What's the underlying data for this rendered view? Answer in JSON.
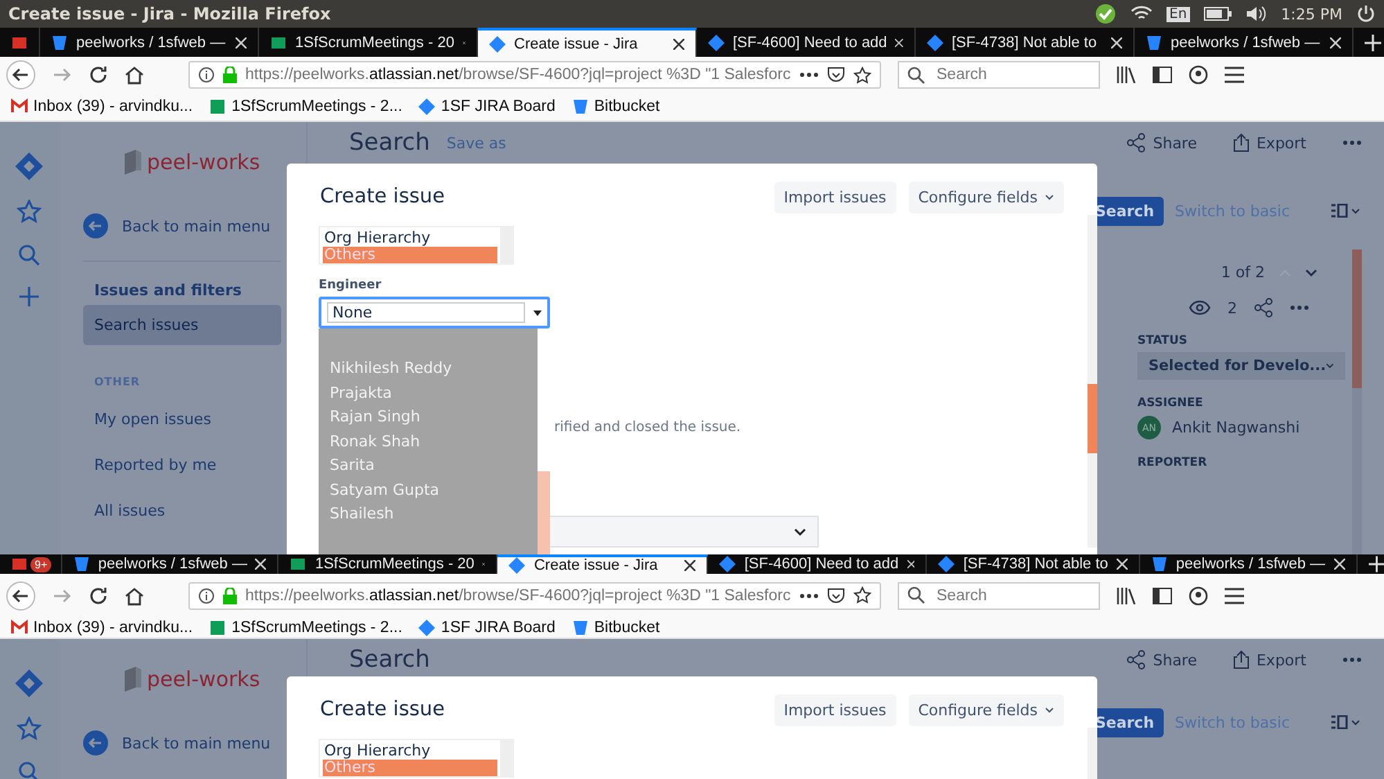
{
  "window": {
    "title": "Create issue - Jira - Mozilla Firefox",
    "language": "En",
    "time": "1:25 PM"
  },
  "frames": [
    {
      "tabs": [
        {
          "kind": "mail",
          "selected": false
        },
        {
          "label": "peelworks / 1sfweb —",
          "kind": "bucket",
          "selected": false
        },
        {
          "label": "1SfScrumMeetings - 20",
          "kind": "sheet",
          "selected": false
        },
        {
          "label": "Create issue - Jira",
          "kind": "jira",
          "selected": true
        },
        {
          "label": "[SF-4600] Need to add",
          "kind": "jira",
          "selected": false
        },
        {
          "label": "[SF-4738] Not able to",
          "kind": "jira",
          "selected": false
        },
        {
          "label": "peelworks / 1sfweb —",
          "kind": "bucket",
          "selected": false
        }
      ],
      "url": {
        "start": "https://peelworks.",
        "domain": "atlassian.net",
        "rest": "/browse/SF-4600?jql=project %3D \"1 Salesforc"
      },
      "search_placeholder": "Search",
      "bookmarks": [
        {
          "label": "Inbox (39) - arvindku...",
          "kind": "mail"
        },
        {
          "label": "1SfScrumMeetings - 2...",
          "kind": "sheet"
        },
        {
          "label": "1SF JIRA Board",
          "kind": "jira"
        },
        {
          "label": "Bitbucket",
          "kind": "bucket"
        }
      ],
      "sidebar": {
        "logo": "peel-works",
        "back": "Back to main menu",
        "section": "Issues and filters",
        "items": [
          {
            "label": "Search issues",
            "selected": true
          }
        ],
        "other_heading": "OTHER",
        "other_items": [
          {
            "label": "My open issues",
            "selected": false
          },
          {
            "label": "Reported by me",
            "selected": false
          },
          {
            "label": "All issues",
            "selected": false
          }
        ]
      },
      "header": {
        "title": "Search",
        "save_as": "Save as",
        "share": "Share",
        "export": "Export"
      },
      "search_button": "Search",
      "switch": "Switch to basic",
      "detail": {
        "pager": "1 of 2",
        "watchers": "2",
        "status_label": "STATUS",
        "status": "Selected for Develo...",
        "assignee_label": "ASSIGNEE",
        "assignee_initials": "AN",
        "assignee": "Ankit Nagwanshi",
        "reporter_label": "REPORTER"
      },
      "modal": {
        "title": "Create issue",
        "import": "Import issues",
        "configure": "Configure fields",
        "listbox": [
          {
            "label": "Org Hierarchy",
            "selected": false
          },
          {
            "label": "Others",
            "selected": true
          }
        ],
        "fields": [
          {
            "kind": "select",
            "label": "Engineer",
            "value": "None",
            "focused": true
          }
        ],
        "dropdown": [
          "Nikhilesh Reddy",
          "Prajakta",
          "Rajan Singh",
          "Ronak Shah",
          "Sarita",
          "Satyam Gupta",
          "Shailesh"
        ],
        "covered_hint": "rified and closed the issue."
      }
    },
    {
      "tabs": [
        {
          "kind": "mail",
          "selected": false,
          "badge": "9+"
        },
        {
          "label": "peelworks / 1sfweb —",
          "kind": "bucket",
          "selected": false
        },
        {
          "label": "1SfScrumMeetings - 20",
          "kind": "sheet",
          "selected": false
        },
        {
          "label": "Create issue - Jira",
          "kind": "jira",
          "selected": true
        },
        {
          "label": "[SF-4600] Need to add",
          "kind": "jira",
          "selected": false
        },
        {
          "label": "[SF-4738] Not able to",
          "kind": "jira",
          "selected": false
        },
        {
          "label": "peelworks / 1sfweb —",
          "kind": "bucket",
          "selected": false
        }
      ],
      "url": {
        "start": "https://peelworks.",
        "domain": "atlassian.net",
        "rest": "/browse/SF-4600?jql=project %3D \"1 Salesforc"
      },
      "search_placeholder": "Search",
      "bookmarks": [
        {
          "label": "Inbox (39) - arvindku...",
          "kind": "mail"
        },
        {
          "label": "1SfScrumMeetings - 2...",
          "kind": "sheet"
        },
        {
          "label": "1SF JIRA Board",
          "kind": "jira"
        },
        {
          "label": "Bitbucket",
          "kind": "bucket"
        }
      ],
      "sidebar": {
        "logo": "peel-works",
        "back": "Back to main menu"
      },
      "header": {
        "title": "Search",
        "share": "Share",
        "export": "Export"
      },
      "search_button": "Search",
      "switch": "Switch to basic",
      "modal": {
        "title": "Create issue",
        "import": "Import issues",
        "configure": "Configure fields",
        "listbox": [
          {
            "label": "Org Hierarchy",
            "selected": false
          },
          {
            "label": "Others",
            "selected": true
          }
        ]
      }
    }
  ]
}
